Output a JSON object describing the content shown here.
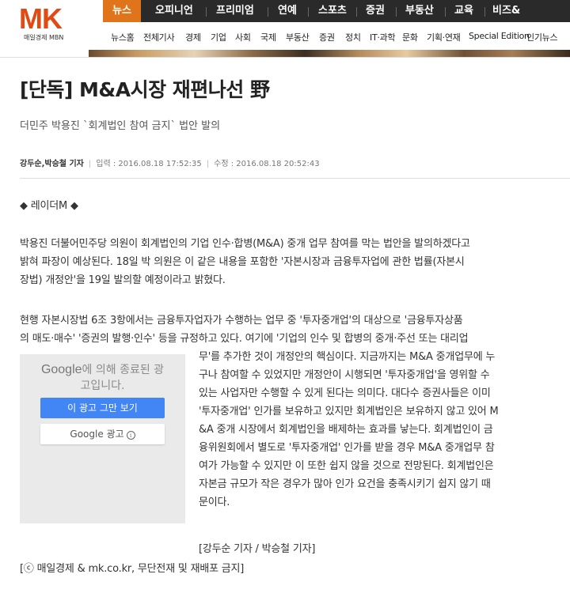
{
  "header": {
    "logo_mark": "MK",
    "logo_sub": "매일경제 MBN",
    "top_nav": [
      "뉴스",
      "오피니언",
      "프리미엄",
      "연예",
      "스포츠",
      "증권",
      "부동산",
      "교육",
      "비즈&"
    ],
    "sub_nav": [
      "뉴스홈",
      "전체기사",
      "경제",
      "기업",
      "사회",
      "국제",
      "부동산",
      "증권",
      "정치",
      "IT·과학",
      "문화",
      "기획·연재",
      "Special Edition",
      "인기뉴스"
    ]
  },
  "article": {
    "title": "[단독] M&A시장 재편나선 野",
    "subtitle": "더민주 박용진 `회계법인 참여 금지` 법안 발의",
    "authors": "강두순,박승철 기자",
    "input_time": "입력 : 2016.08.18 17:52:35",
    "modified_time": "수정 : 2016.08.18 20:52:43",
    "section_tag": "◆ 레이더M ◆",
    "paragraph1": [
      "박용진 더불어민주당 의원이 회계법인의 기업 인수·합병(M&A) 중개 업무 참여를 막는 법안을 발의하겠다고",
      "밝혀 파장이 예상된다. 18일 박 의원은 이 같은 내용을 포함한 '자본시장과 금융투자업에 관한 법률(자본시",
      "장법) 개정안'을 19일 발의할 예정이라고 밝혔다."
    ],
    "paragraph2_full": [
      "현행 자본시장법 6조 3항에서는 금융투자업자가 수행하는 업무 중 '투자중개업'의 대상으로 '금융투자상품",
      "의 매도·매수' '증권의 발행·인수' 등을 규정하고 있다. 여기에 '기업의 인수 및 합병의 중개·주선 또는 대리업"
    ],
    "paragraph2_wrapped": [
      "무'를 추가한 것이 개정안의 핵심이다. 지금까지는 M&A 중개업무에 누",
      "구나 참여할 수 있었지만 개정안이 시행되면 '투자중개업'을 영위할 수",
      "있는 사업자만 수행할 수 있게 된다는 의미다. 대다수 증권사들은 이미",
      "'투자중개업' 인가를 보유하고 있지만 회계법인은 보유하지 않고 있어 M",
      "&A 중개 시장에서 회계법인을 배제하는 효과를 낳는다. 회계법인이 금",
      "융위원회에서 별도로 '투자중개업' 인가를 받을 경우 M&A 중개업무 참",
      "여가 가능할 수 있지만 이 또한 쉽지 않을 것으로 전망된다. 회계법인은",
      "자본금 규모가 작은 경우가 많아 인가 요건을 충족시키기 쉽지 않기 때",
      "문이다."
    ],
    "reporter_sign": "[강두순 기자 / 박승철 기자]",
    "copyright": "[ⓒ 매일경제 & mk.co.kr, 무단전재 및 재배포 금지]"
  },
  "ad": {
    "google_word": "Google",
    "message_tail": "에 의해 종료된 광",
    "message_line2": "고입니다.",
    "stop_button": "이 광고 그만 보기",
    "google_ads_button": "Google 광고",
    "info_glyph": "i"
  }
}
